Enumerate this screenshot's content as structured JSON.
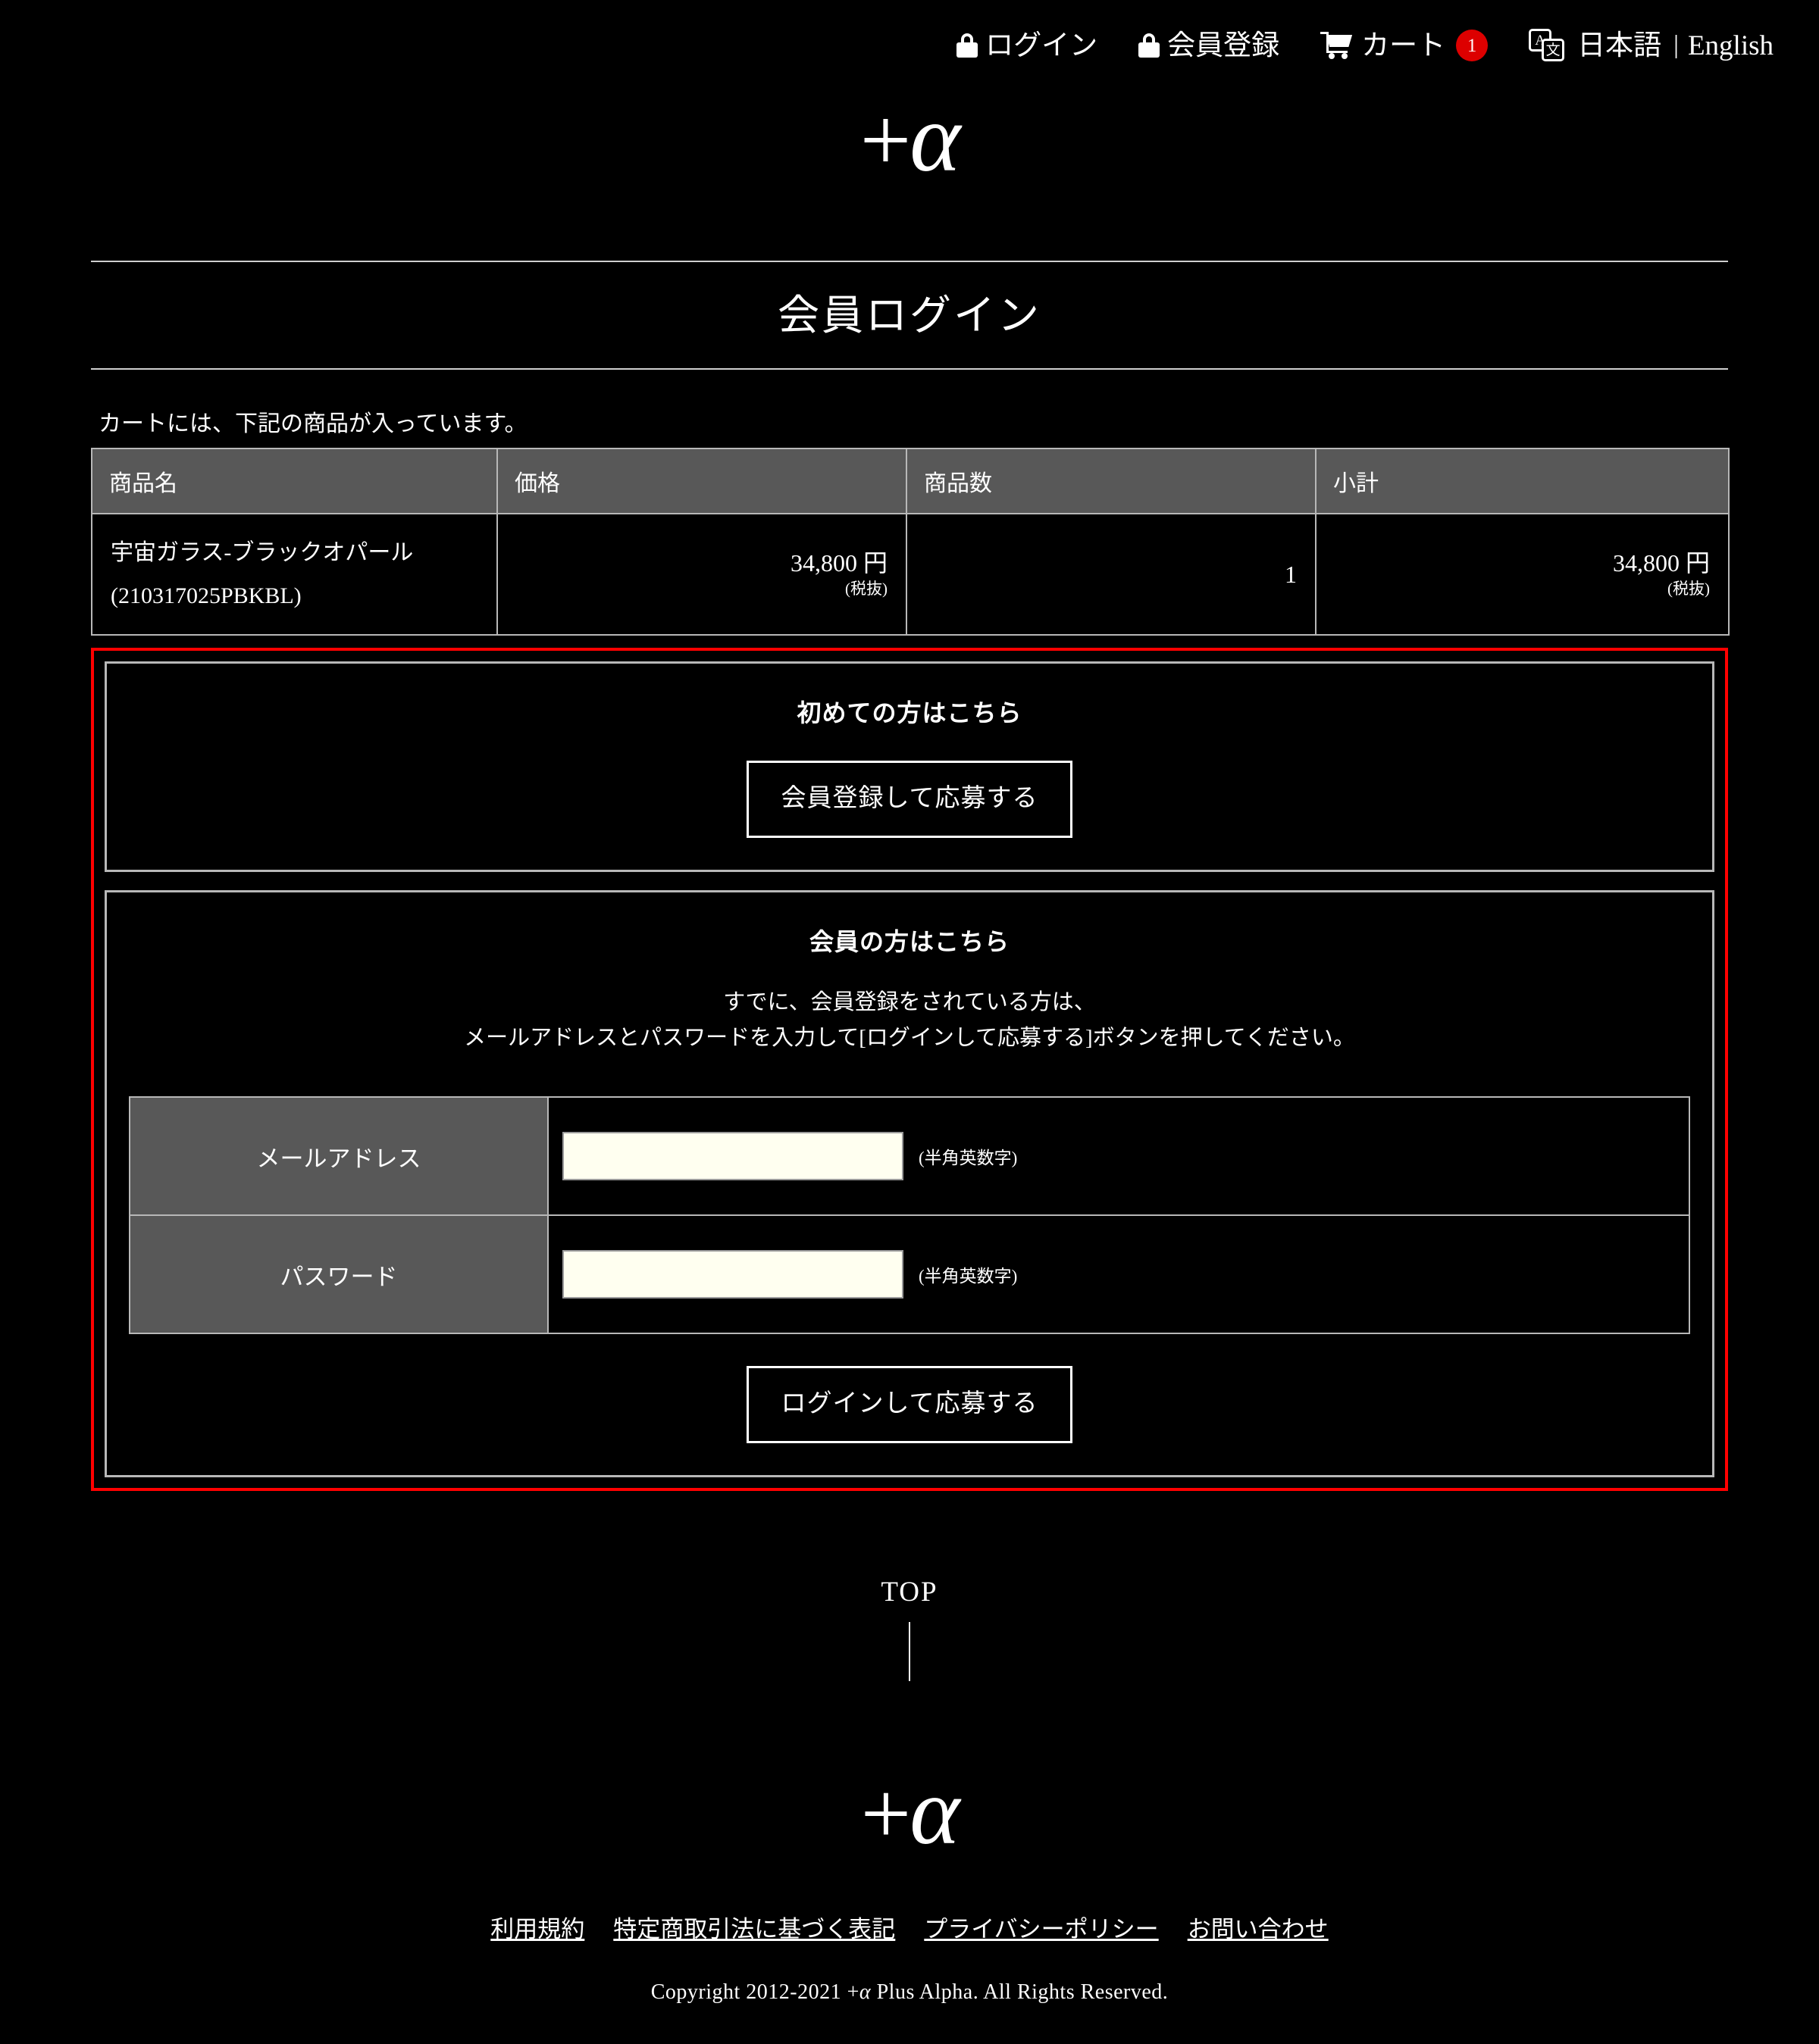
{
  "theme": {
    "background": "#000000",
    "text": "#ffffff",
    "accent_red": "#ff0000",
    "badge_red": "#dd0000",
    "header_gray": "#585858",
    "border_gray": "#b8b8b8",
    "input_bg": "#fffff0"
  },
  "header": {
    "nav": [
      {
        "icon": "lock-icon",
        "label": "ログイン"
      },
      {
        "icon": "lock-icon",
        "label": "会員登録"
      },
      {
        "icon": "cart-icon",
        "label": "カート",
        "badge": "1"
      }
    ],
    "language": {
      "icon": "translate-icon",
      "icon_glyph_a": "A",
      "icon_glyph_b": "文",
      "current": "日本語",
      "separator": "|",
      "other": "English"
    },
    "logo": {
      "plus": "+",
      "alpha": "α"
    }
  },
  "page": {
    "title": "会員ログイン"
  },
  "cart": {
    "note": "カートには、下記の商品が入っています。",
    "columns": [
      "商品名",
      "価格",
      "商品数",
      "小計"
    ],
    "rows": [
      {
        "name": "宇宙ガラス-ブラックオパール",
        "code": "(210317025PBKBL)",
        "price": "34,800 円",
        "price_tax_note": "(税抜)",
        "quantity": "1",
        "subtotal": "34,800 円",
        "subtotal_tax_note": "(税抜)"
      }
    ]
  },
  "new_member": {
    "heading": "初めての方はこちら",
    "button_label": "会員登録して応募する"
  },
  "existing_member": {
    "heading": "会員の方はこちら",
    "description_line1": "すでに、会員登録をされている方は、",
    "description_line2": "メールアドレスとパスワードを入力して[ログインして応募する]ボタンを押してください。",
    "fields": [
      {
        "label": "メールアドレス",
        "value": "",
        "placeholder": "",
        "hint": "(半角英数字)"
      },
      {
        "label": "パスワード",
        "value": "",
        "placeholder": "",
        "hint": "(半角英数字)"
      }
    ],
    "button_label": "ログインして応募する"
  },
  "top_link": {
    "label": "TOP"
  },
  "footer": {
    "logo": {
      "plus": "+",
      "alpha": "α"
    },
    "links": [
      "利用規約",
      "特定商取引法に基づく表記",
      "プライバシーポリシー",
      "お問い合わせ"
    ],
    "copyright_prefix": "Copyright 2012-2021 +",
    "copyright_alpha": "α",
    "copyright_suffix": " Plus Alpha. All Rights Reserved."
  }
}
